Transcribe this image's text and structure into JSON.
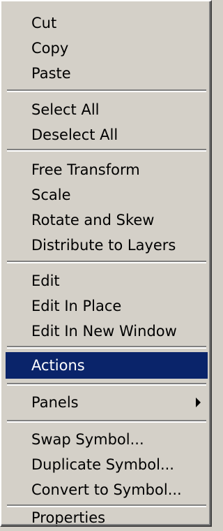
{
  "menu": {
    "items": [
      {
        "label": "Cut"
      },
      {
        "label": "Copy"
      },
      {
        "label": "Paste"
      },
      {
        "label": "Select All"
      },
      {
        "label": "Deselect All"
      },
      {
        "label": "Free Transform"
      },
      {
        "label": "Scale"
      },
      {
        "label": "Rotate and Skew"
      },
      {
        "label": "Distribute to Layers"
      },
      {
        "label": "Edit"
      },
      {
        "label": "Edit In Place"
      },
      {
        "label": "Edit In New Window"
      },
      {
        "label": "Actions",
        "selected": true
      },
      {
        "label": "Panels",
        "submenu": true
      },
      {
        "label": "Swap Symbol..."
      },
      {
        "label": "Duplicate Symbol..."
      },
      {
        "label": "Convert to Symbol..."
      },
      {
        "label": "Properties"
      }
    ]
  },
  "colors": {
    "menu_background": "#d4d0c8",
    "highlight": "#0a246a",
    "highlight_text": "#ffffff"
  }
}
